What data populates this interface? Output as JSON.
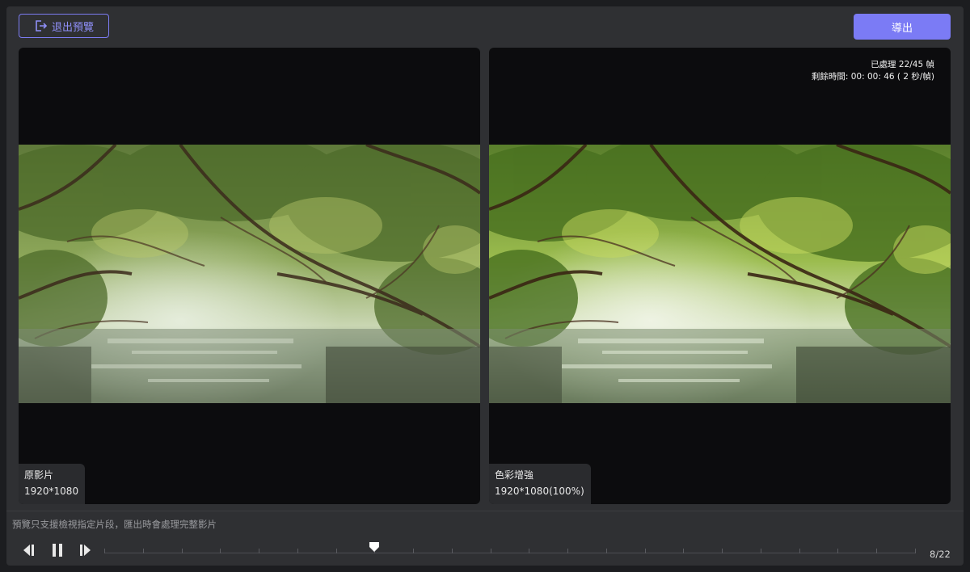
{
  "toolbar": {
    "exit_label": "退出預覽",
    "export_label": "導出",
    "accent_color": "#7b7bf5"
  },
  "preview": {
    "original": {
      "title": "原影片",
      "resolution": "1920*1080"
    },
    "enhanced": {
      "title": "色彩增強",
      "resolution": "1920*1080(100%)",
      "processed": "已處理 22/45 幀",
      "remaining": "剩餘時間: 00: 00: 46 ( 2 秒/幀)"
    },
    "image_description": "mangrove tunnel over water"
  },
  "playback": {
    "notice": "預覽只支援檢視指定片段，匯出時會處理完整影片",
    "current_frame": 8,
    "total_frames": 22,
    "frame_counter": "8/22",
    "icons": [
      "step-back-icon",
      "pause-icon",
      "step-forward-icon",
      "scrubber-handle-icon",
      "exit-icon"
    ]
  }
}
